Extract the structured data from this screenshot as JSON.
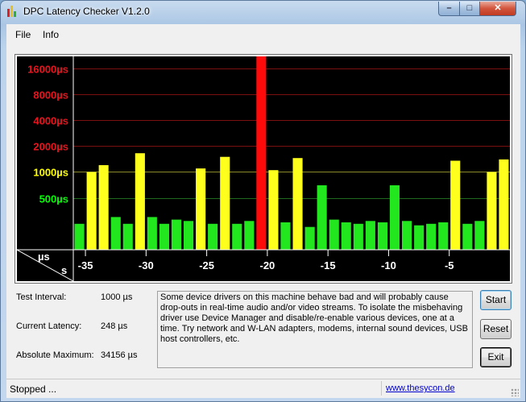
{
  "window": {
    "title": "DPC Latency Checker V1.2.0",
    "controls": {
      "minimize": "–",
      "maximize": "□",
      "close": "✕"
    }
  },
  "menu": [
    {
      "label": "File"
    },
    {
      "label": "Info"
    }
  ],
  "chart_data": {
    "type": "bar",
    "y_unit_label": "µs",
    "x_unit_label": "s",
    "yticks": [
      {
        "label": "16000µs",
        "value": 16000,
        "color": "#e8141e"
      },
      {
        "label": "8000µs",
        "value": 8000,
        "color": "#e8141e"
      },
      {
        "label": "4000µs",
        "value": 4000,
        "color": "#e8141e"
      },
      {
        "label": "2000µs",
        "value": 2000,
        "color": "#e8141e"
      },
      {
        "label": "1000µs",
        "value": 1000,
        "color": "#ffff00"
      },
      {
        "label": "500µs",
        "value": 500,
        "color": "#00ff00"
      }
    ],
    "xticks": [
      -35,
      -30,
      -25,
      -20,
      -15,
      -10,
      -5
    ],
    "x_range": [
      -36,
      0
    ],
    "y_log_range": [
      125,
      22000
    ],
    "bars": [
      {
        "t": -36,
        "us": 250
      },
      {
        "t": -35,
        "us": 1000
      },
      {
        "t": -34,
        "us": 1200
      },
      {
        "t": -33,
        "us": 300
      },
      {
        "t": -32,
        "us": 250
      },
      {
        "t": -31,
        "us": 1650
      },
      {
        "t": -30,
        "us": 300
      },
      {
        "t": -29,
        "us": 250
      },
      {
        "t": -28,
        "us": 280
      },
      {
        "t": -27,
        "us": 270
      },
      {
        "t": -26,
        "us": 1100
      },
      {
        "t": -25,
        "us": 250
      },
      {
        "t": -24,
        "us": 1500
      },
      {
        "t": -23,
        "us": 250
      },
      {
        "t": -22,
        "us": 270
      },
      {
        "t": -21,
        "us": 34156
      },
      {
        "t": -20,
        "us": 1050
      },
      {
        "t": -19,
        "us": 260
      },
      {
        "t": -18,
        "us": 1450
      },
      {
        "t": -17,
        "us": 230
      },
      {
        "t": -16,
        "us": 700
      },
      {
        "t": -15,
        "us": 280
      },
      {
        "t": -14,
        "us": 260
      },
      {
        "t": -13,
        "us": 250
      },
      {
        "t": -12,
        "us": 270
      },
      {
        "t": -11,
        "us": 260
      },
      {
        "t": -10,
        "us": 700
      },
      {
        "t": -9,
        "us": 270
      },
      {
        "t": -8,
        "us": 240
      },
      {
        "t": -7,
        "us": 250
      },
      {
        "t": -6,
        "us": 260
      },
      {
        "t": -5,
        "us": 1350
      },
      {
        "t": -4,
        "us": 250
      },
      {
        "t": -3,
        "us": 270
      },
      {
        "t": -2,
        "us": 1000
      },
      {
        "t": -1,
        "us": 1400
      }
    ],
    "colors": {
      "green": "#22e61e",
      "yellow": "#ffff1e",
      "red": "#ff0a0a",
      "grid_red": "#7a1010",
      "grid_yellow": "#8a8a28",
      "grid_green": "#1f6a1f",
      "background": "#000000"
    }
  },
  "info": {
    "test_interval_label": "Test Interval:",
    "test_interval_value": "1000 µs",
    "current_latency_label": "Current Latency:",
    "current_latency_value": "248 µs",
    "absolute_maximum_label": "Absolute Maximum:",
    "absolute_maximum_value": "34156 µs"
  },
  "message": "Some device drivers on this machine behave bad and will probably cause drop-outs in real-time audio and/or video streams. To isolate the misbehaving driver use Device Manager and disable/re-enable various devices, one at a time. Try network and W-LAN adapters, modems, internal sound devices, USB host controllers, etc.",
  "buttons": {
    "start": "Start",
    "reset": "Reset",
    "exit": "Exit"
  },
  "status": {
    "text": "Stopped ...",
    "link": "www.thesycon.de"
  }
}
